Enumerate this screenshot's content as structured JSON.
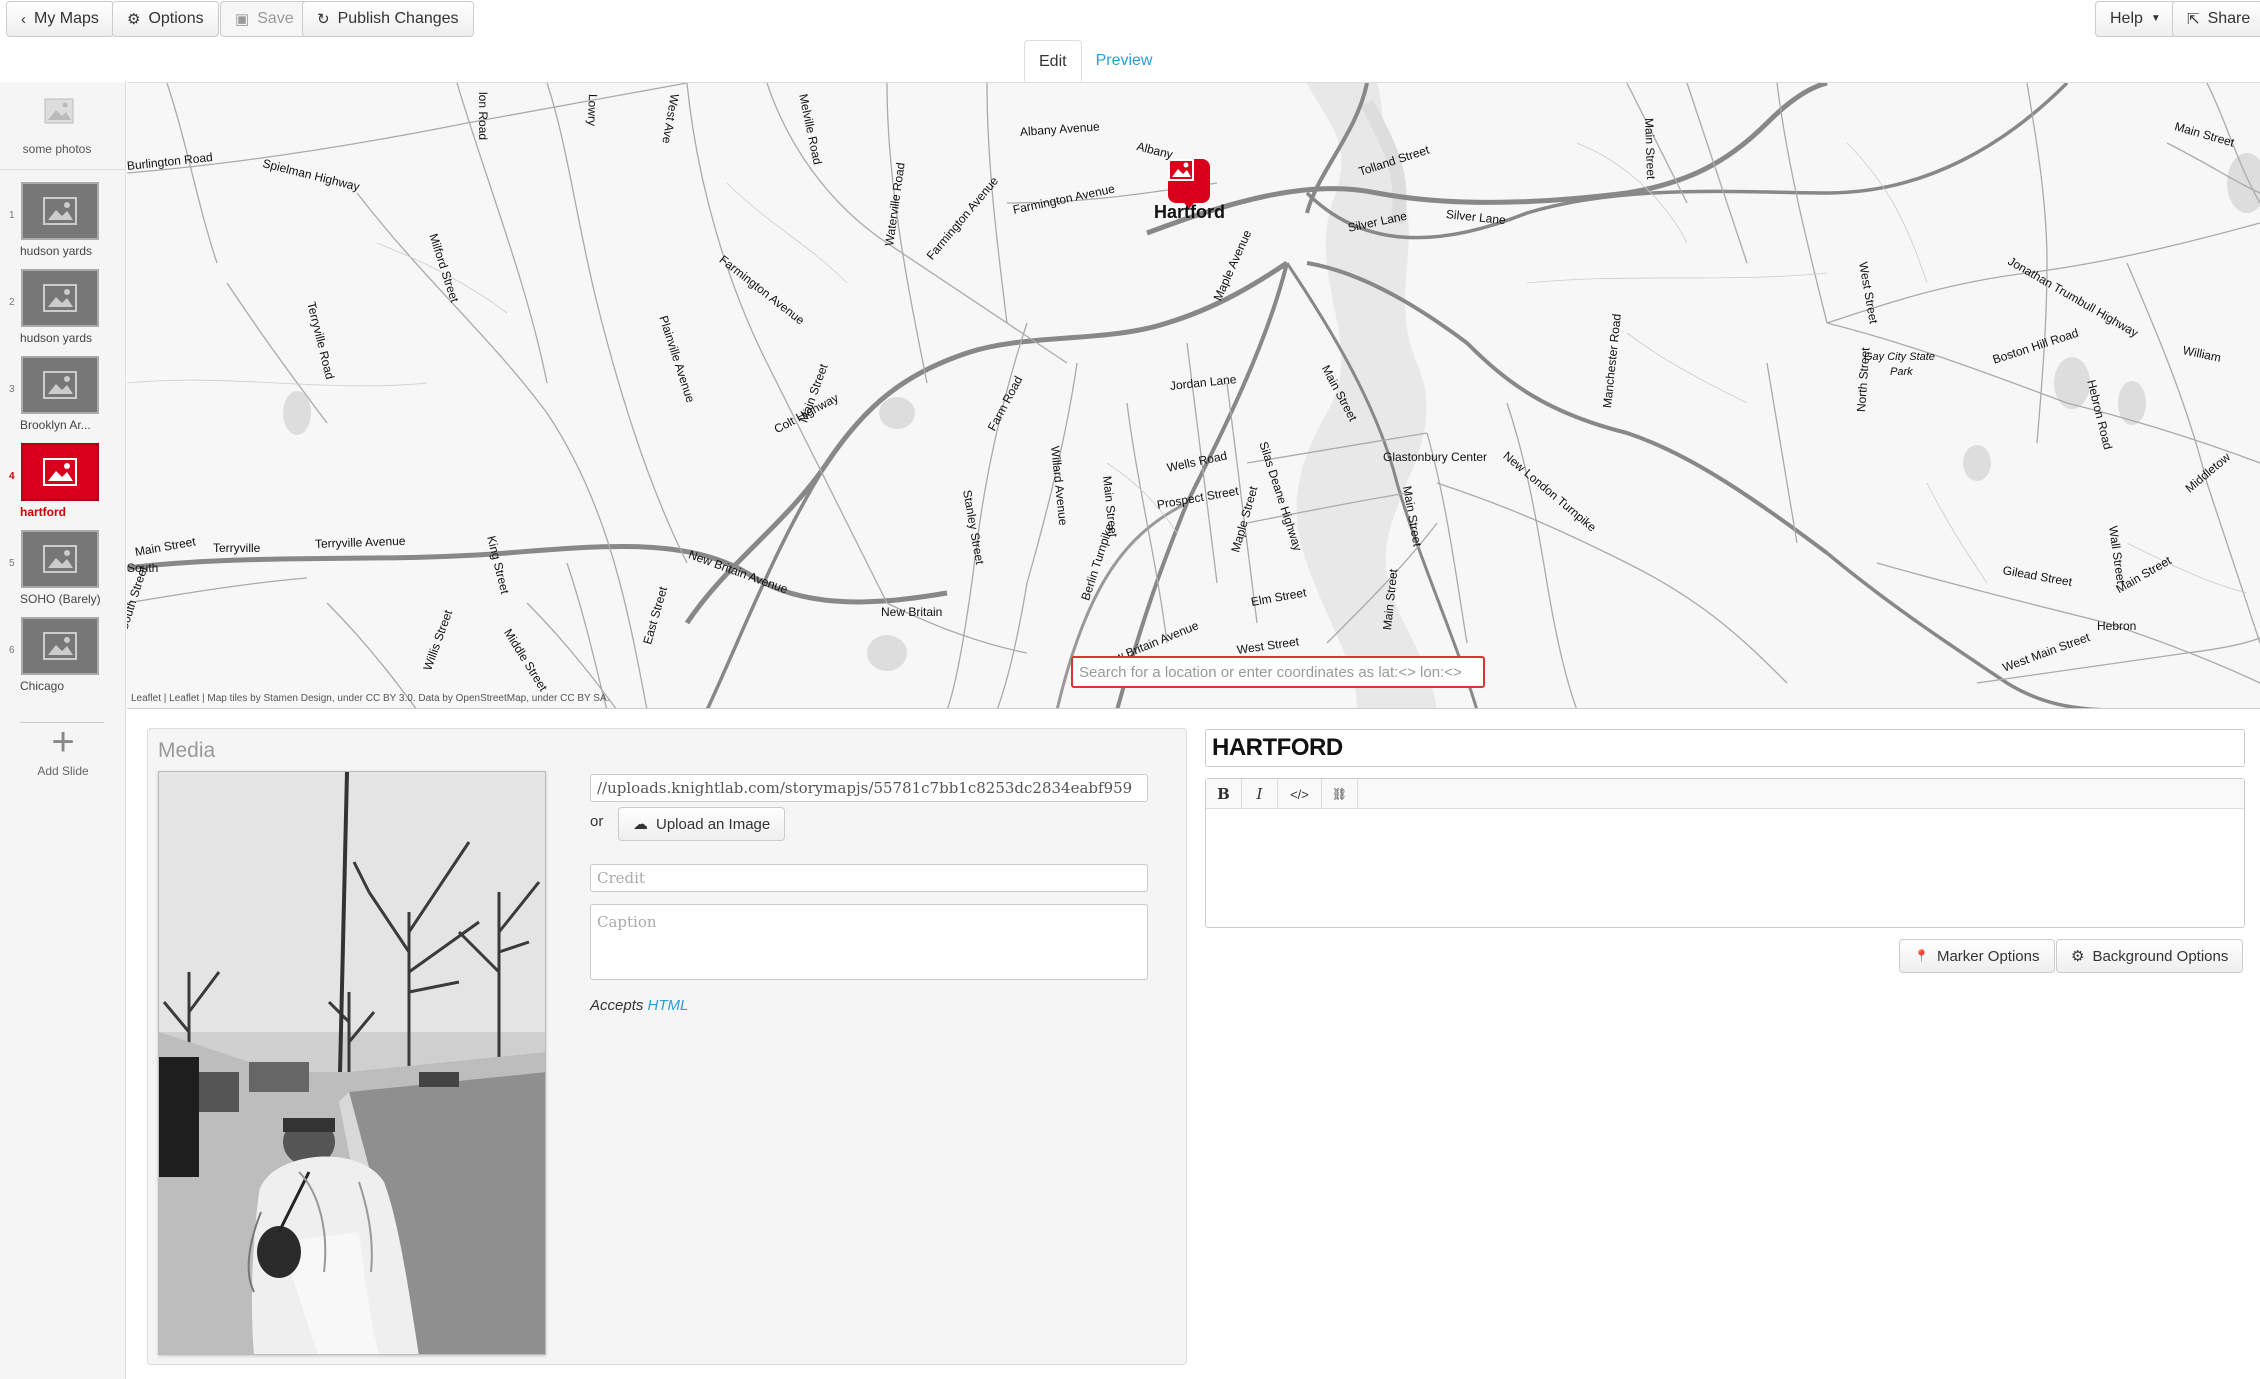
{
  "topbar": {
    "my_maps": "My Maps",
    "options": "Options",
    "save": "Save",
    "publish": "Publish Changes",
    "help": "Help",
    "share": "Share"
  },
  "tabs": {
    "edit": "Edit",
    "preview": "Preview"
  },
  "sidebar": {
    "cover_label": "some photos",
    "slides": [
      {
        "num": "1",
        "label": "hudson yards"
      },
      {
        "num": "2",
        "label": "hudson yards"
      },
      {
        "num": "3",
        "label": "Brooklyn Ar..."
      },
      {
        "num": "4",
        "label": "hartford"
      },
      {
        "num": "5",
        "label": "SOHO (Barely)"
      },
      {
        "num": "6",
        "label": "Chicago"
      }
    ],
    "add_slide": "Add Slide"
  },
  "map": {
    "city": "Hartford",
    "search_placeholder": "Search for a location or enter coordinates as lat:<> lon:<>",
    "attribution": "Leaflet | Leaflet | Map tiles by Stamen Design, under CC BY 3.0. Data by OpenStreetMap, under CC BY SA.",
    "labels": {
      "burlington_road": "Burlington Road",
      "spielman_highway": "Spielman Highway",
      "albany_avenue": "Albany Avenue",
      "albany": "Albany",
      "farmington_avenue": "Farmington Avenue",
      "tolland_street": "Tolland Street",
      "silver_lane_1": "Silver Lane",
      "silver_lane_2": "Silver Lane",
      "main_street_ne": "Main Street",
      "main_street_far": "Main Street",
      "milford_street": "Milford Street",
      "terryville_road": "Terryville Road",
      "farmington_avenue_2": "Farmington Avenue",
      "waterville_road": "Waterville Road",
      "farmington_avenue_3": "Farmington Avenue",
      "maple_avenue": "Maple Avenue",
      "west_street": "West Street",
      "jonathan_trumbull": "Jonathan Trumbull Highway",
      "plainville_avenue": "Plainville Avenue",
      "main_street_2": "Main Street",
      "colt_highway": "Colt Highway",
      "farm_road": "Farm Road",
      "jordan_lane": "Jordan Lane",
      "main_street_3": "Main Street",
      "gay_city": "Gay City State",
      "park": "Park",
      "boston_hill": "Boston Hill Road",
      "williams": "William",
      "manchester_road": "Manchester Road",
      "north_street": "North Street",
      "hebron_road": "Hebron Road",
      "glastonbury_center": "Glastonbury Center",
      "new_london_turnpike": "New London Turnpike",
      "wells_road": "Wells Road",
      "silas_deane": "Silas Deane Highway",
      "willard_avenue": "Willard Avenue",
      "main_street_4": "Main Street",
      "prospect_street": "Prospect Street",
      "stanley_street": "Stanley Street",
      "main_street_w": "Main Street",
      "terryville": "Terryville",
      "terryville_avenue": "Terryville Avenue",
      "king_street": "King Street",
      "new_britain_avenue": "New Britain Avenue",
      "maple_street": "Maple Street",
      "main_street_5": "Main Street",
      "berlin_turnpike": "Berlin Turnpike",
      "gilead_street": "Gilead Street",
      "main_street_6": "Main Street",
      "hebron": "Hebron",
      "wall_street": "Wall Street",
      "middletown": "Middletow",
      "south": "South",
      "south_street": "South Street",
      "willis_street": "Willis Street",
      "middle_street": "Middle Street",
      "east_street": "East Street",
      "new_britain": "New Britain",
      "new_britain_avenue_2": "New Britain Avenue",
      "elm_street": "Elm Street",
      "west_street_2": "West Street",
      "main_street_7": "Main Street",
      "west_main_street": "West Main Street",
      "main_street_top": "Main Street",
      "lowry": "Lowry",
      "west_ave": "West Ave",
      "melville": "Melville Road",
      "lon_road": "lon Road"
    }
  },
  "media": {
    "title": "Media",
    "url": "//uploads.knightlab.com/storymapjs/55781c7bb1c8253dc2834eabf959",
    "or": "or",
    "upload": "Upload an Image",
    "credit_placeholder": "Credit",
    "caption_placeholder": "Caption",
    "accepts": "Accepts",
    "accepts_link": "HTML"
  },
  "text": {
    "headline": "HARTFORD",
    "toolbar": {
      "bold": "B",
      "italic": "I",
      "code": "</>",
      "link": "🔗"
    },
    "body": ""
  },
  "buttons": {
    "marker_options": "Marker Options",
    "background_options": "Background Options"
  },
  "colors": {
    "accent_red": "#d9001b",
    "link_blue": "#2a9fd6"
  }
}
